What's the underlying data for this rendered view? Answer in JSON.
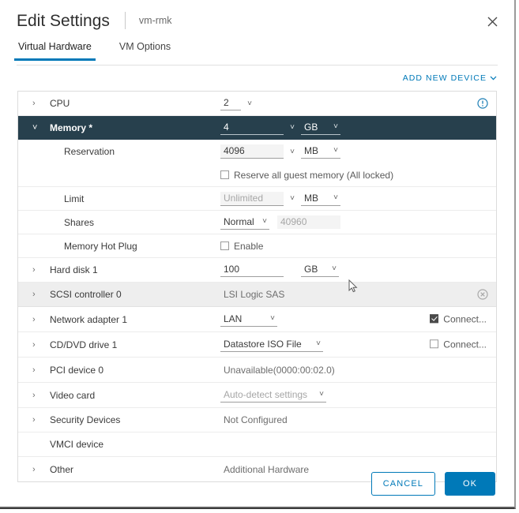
{
  "window": {
    "title": "Edit Settings",
    "subtitle": "vm-rmk",
    "close_icon": "close-icon"
  },
  "tabs": [
    {
      "label": "Virtual Hardware",
      "active": true
    },
    {
      "label": "VM Options",
      "active": false
    }
  ],
  "toolbar": {
    "add_new_device": "ADD NEW DEVICE"
  },
  "colors": {
    "accent_blue": "#0079b8",
    "selected_row": "#27404d",
    "hover_row": "#eeeeee",
    "border": "#dcdcdc"
  },
  "rows": {
    "cpu": {
      "label": "CPU",
      "value": "2",
      "info_icon": "info-icon"
    },
    "memory": {
      "label": "Memory *",
      "value": "4",
      "unit": "GB"
    },
    "reservation": {
      "label": "Reservation",
      "value": "4096",
      "unit": "MB",
      "reserve_all_label": "Reserve all guest memory (All locked)",
      "reserve_all_checked": false
    },
    "limit": {
      "label": "Limit",
      "value": "Unlimited",
      "unit": "MB"
    },
    "shares": {
      "label": "Shares",
      "value": "Normal",
      "amount": "40960"
    },
    "memory_hot_plug": {
      "label": "Memory Hot Plug",
      "enable_label": "Enable",
      "enable_checked": false
    },
    "hard_disk": {
      "label": "Hard disk 1",
      "value": "100",
      "unit": "GB"
    },
    "scsi_controller": {
      "label": "SCSI controller 0",
      "value": "LSI Logic SAS",
      "remove_icon": "remove-icon"
    },
    "network_adapter": {
      "label": "Network adapter 1",
      "value": "LAN",
      "connect_label": "Connect...",
      "connect_checked": true
    },
    "cd_dvd": {
      "label": "CD/DVD drive 1",
      "value": "Datastore ISO File",
      "connect_label": "Connect...",
      "connect_checked": false
    },
    "pci_device": {
      "label": "PCI device 0",
      "value": "Unavailable(0000:00:02.0)"
    },
    "video_card": {
      "label": "Video card",
      "value": "Auto-detect settings"
    },
    "security_devices": {
      "label": "Security Devices",
      "value": "Not Configured"
    },
    "vmci_device": {
      "label": "VMCI device",
      "value": ""
    },
    "other": {
      "label": "Other",
      "value": "Additional Hardware"
    }
  },
  "footer": {
    "cancel": "CANCEL",
    "ok": "OK"
  }
}
